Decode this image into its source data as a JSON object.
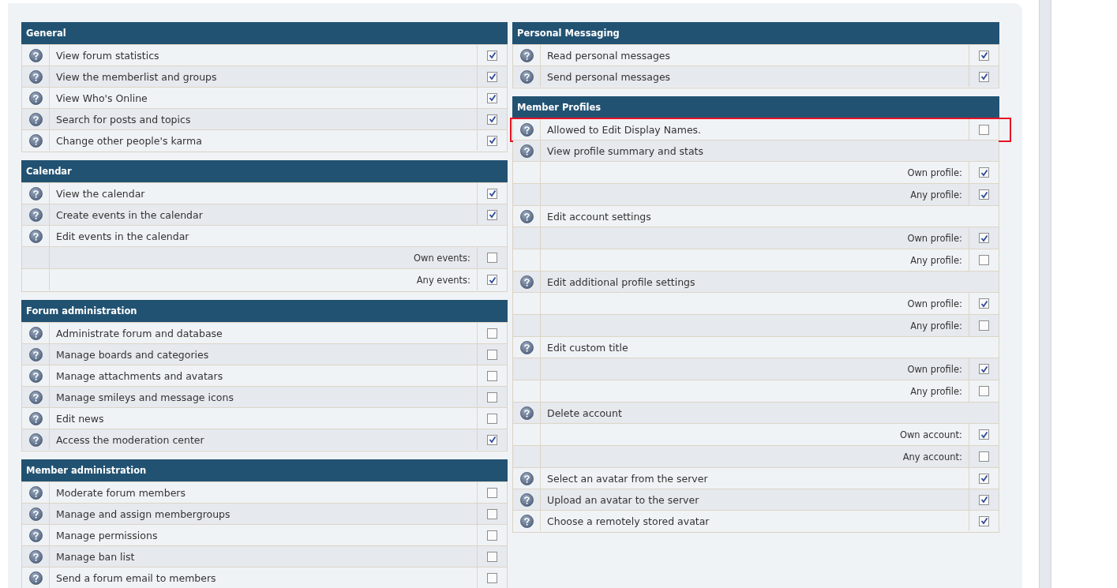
{
  "columns": [
    {
      "sections": [
        {
          "title": "General",
          "rows": [
            {
              "label": "View forum statistics",
              "checked": true
            },
            {
              "label": "View the memberlist and groups",
              "checked": true
            },
            {
              "label": "View Who's Online",
              "checked": true
            },
            {
              "label": "Search for posts and topics",
              "checked": true
            },
            {
              "label": "Change other people's karma",
              "checked": true
            }
          ]
        },
        {
          "title": "Calendar",
          "rows": [
            {
              "label": "View the calendar",
              "checked": true
            },
            {
              "label": "Create events in the calendar",
              "checked": true
            },
            {
              "label": "Edit events in the calendar",
              "options": [
                {
                  "label": "Own events:",
                  "checked": false
                },
                {
                  "label": "Any events:",
                  "checked": true
                }
              ]
            }
          ]
        },
        {
          "title": "Forum administration",
          "rows": [
            {
              "label": "Administrate forum and database",
              "checked": false
            },
            {
              "label": "Manage boards and categories",
              "checked": false
            },
            {
              "label": "Manage attachments and avatars",
              "checked": false
            },
            {
              "label": "Manage smileys and message icons",
              "checked": false
            },
            {
              "label": "Edit news",
              "checked": false
            },
            {
              "label": "Access the moderation center",
              "checked": true
            }
          ]
        },
        {
          "title": "Member administration",
          "rows": [
            {
              "label": "Moderate forum members",
              "checked": false
            },
            {
              "label": "Manage and assign membergroups",
              "checked": false
            },
            {
              "label": "Manage permissions",
              "checked": false
            },
            {
              "label": "Manage ban list",
              "checked": false
            },
            {
              "label": "Send a forum email to members",
              "checked": false
            }
          ]
        }
      ]
    },
    {
      "sections": [
        {
          "title": "Personal Messaging",
          "rows": [
            {
              "label": "Read personal messages",
              "checked": true
            },
            {
              "label": "Send personal messages",
              "checked": true
            }
          ]
        },
        {
          "title": "Member Profiles",
          "rows": [
            {
              "label": "Allowed to Edit Display Names.",
              "checked": false,
              "highlighted": true
            },
            {
              "label": "View profile summary and stats",
              "options": [
                {
                  "label": "Own profile:",
                  "checked": true
                },
                {
                  "label": "Any profile:",
                  "checked": true
                }
              ]
            },
            {
              "label": "Edit account settings",
              "options": [
                {
                  "label": "Own profile:",
                  "checked": true
                },
                {
                  "label": "Any profile:",
                  "checked": false
                }
              ]
            },
            {
              "label": "Edit additional profile settings",
              "options": [
                {
                  "label": "Own profile:",
                  "checked": true
                },
                {
                  "label": "Any profile:",
                  "checked": false
                }
              ]
            },
            {
              "label": "Edit custom title",
              "options": [
                {
                  "label": "Own profile:",
                  "checked": true
                },
                {
                  "label": "Any profile:",
                  "checked": false
                }
              ]
            },
            {
              "label": "Delete account",
              "options": [
                {
                  "label": "Own account:",
                  "checked": true
                },
                {
                  "label": "Any account:",
                  "checked": false
                }
              ]
            },
            {
              "label": "Select an avatar from the server",
              "checked": true
            },
            {
              "label": "Upload an avatar to the server",
              "checked": true
            },
            {
              "label": "Choose a remotely stored avatar",
              "checked": true
            }
          ]
        }
      ]
    }
  ]
}
